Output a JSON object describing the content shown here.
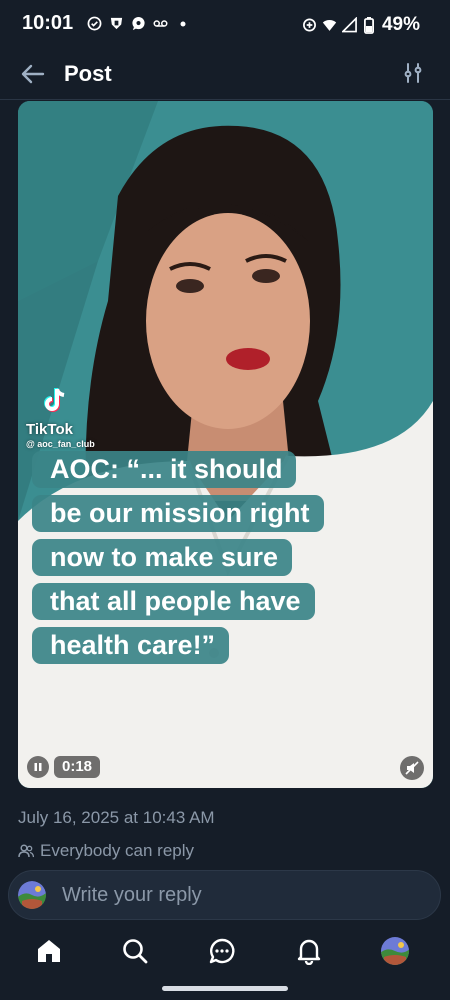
{
  "status_bar": {
    "time": "10:01",
    "battery": "49%",
    "icons": [
      "check-circle-icon",
      "shield-icon",
      "message-bubble-icon",
      "voicemail-icon",
      "dot-icon",
      "data-saver-icon",
      "wifi-icon",
      "signal-icon",
      "battery-icon"
    ]
  },
  "header": {
    "title": "Post",
    "back_icon": "arrow-left-icon",
    "settings_icon": "sliders-icon"
  },
  "video": {
    "watermark_name": "TikTok",
    "watermark_handle": "@ aoc_fan_club",
    "caption_lines": [
      "AOC: “... it should",
      "be our mission right",
      "now to make sure",
      "that all people have",
      "health care!”"
    ],
    "duration": "0:18",
    "colors": {
      "background": "#3b8e91",
      "caption_bg": "#3b8488"
    }
  },
  "post": {
    "date": "July 16, 2025 at 10:43 AM",
    "reply_permission": "Everybody can reply"
  },
  "reply": {
    "placeholder": "Write your reply"
  },
  "nav": {
    "items": [
      "home-icon",
      "search-icon",
      "chat-icon",
      "bell-icon",
      "profile-avatar"
    ]
  },
  "theme": {
    "background": "#151d28",
    "muted_text": "#8b98a8",
    "text": "#ffffff"
  }
}
